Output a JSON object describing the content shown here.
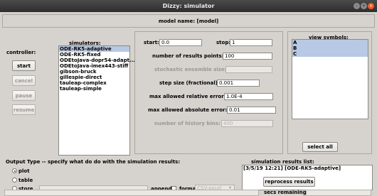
{
  "window": {
    "title": "Dizzy: simulator"
  },
  "header": {
    "model_name": "model name: [model]"
  },
  "controller": {
    "label": "controller:",
    "start": "start",
    "cancel": "cancel",
    "pause": "pause",
    "resume": "resume"
  },
  "simulators": {
    "label": "simulators:",
    "items": [
      "ODE-RK5-adaptive",
      "ODE-RK5-fixed",
      "ODEtoJava-dopr54-adapt...",
      "ODEtoJava-imex443-stiff",
      "gibson-bruck",
      "gillespie-direct",
      "tauleap-complex",
      "tauleap-simple"
    ],
    "selected_index": 0
  },
  "params": {
    "start_label": "start:",
    "start_value": "0.0",
    "stop_label": "stop:",
    "stop_value": "1",
    "num_points_label": "number of results points:",
    "num_points_value": "100",
    "ensemble_label": "stochastic ensemble size:",
    "ensemble_value": "",
    "step_label": "step size (fractional):",
    "step_value": "0.001",
    "rel_err_label": "max allowed relative error:",
    "rel_err_value": "1.0E-4",
    "abs_err_label": "max allowed absolute error:",
    "abs_err_value": "0.01",
    "history_label": "number of history bins:",
    "history_value": "400"
  },
  "view_symbols": {
    "label": "view symbols:",
    "items": [
      "A",
      "B",
      "C"
    ],
    "select_all": "select all"
  },
  "output": {
    "label": "Output Type -- specify what do do with the simulation results:",
    "plot": "plot",
    "table": "table",
    "store": "store",
    "append": "append:",
    "format": "format:",
    "format_value": "CSV-excel"
  },
  "results": {
    "label": "simulation results list:",
    "items": [
      "[3/5/19 12:21] [ODE-RK5-adaptive]"
    ],
    "reprocess": "reprocess results"
  },
  "status": {
    "secs_remaining": "secs remaining:"
  }
}
